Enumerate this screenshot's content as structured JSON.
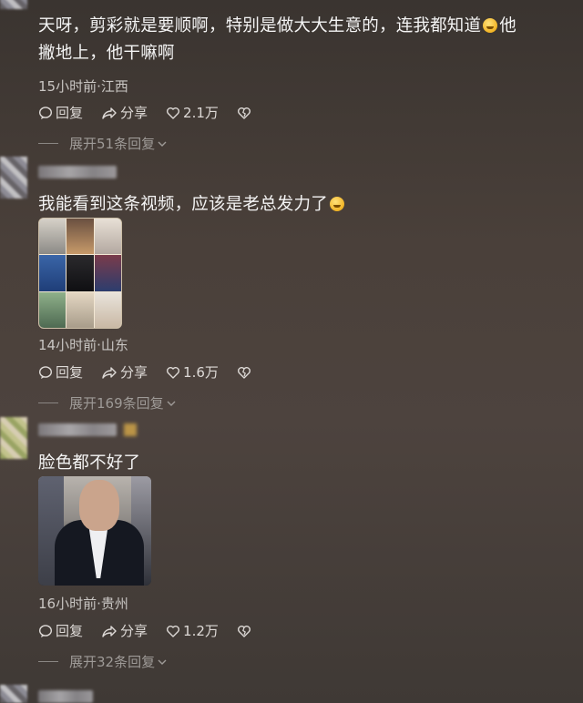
{
  "comments": [
    {
      "text_line1": "天呀，剪彩就是要顺啊，特别是做大大生意的，连我都知道",
      "text_line1_tail": "他",
      "text_line2": "撇地上，他干嘛啊",
      "meta": "15小时前·江西",
      "reply_label": "回复",
      "share_label": "分享",
      "like_count": "2.1万",
      "expand_label": "展开51条回复"
    },
    {
      "text": "我能看到这条视频，应该是老总发力了",
      "meta": "14小时前·山东",
      "reply_label": "回复",
      "share_label": "分享",
      "like_count": "1.6万",
      "expand_label": "展开169条回复"
    },
    {
      "text": "脸色都不好了",
      "meta": "16小时前·贵州",
      "reply_label": "回复",
      "share_label": "分享",
      "like_count": "1.2万",
      "expand_label": "展开32条回复"
    }
  ],
  "icons": {
    "reply": "speech-bubble-icon",
    "share": "share-arrow-icon",
    "like": "heart-icon",
    "dislike": "broken-heart-icon",
    "expand": "chevron-down-icon"
  },
  "colors": {
    "meta": "#c9c6c3",
    "text": "#f4f4f4",
    "expand": "#9e9a97"
  }
}
